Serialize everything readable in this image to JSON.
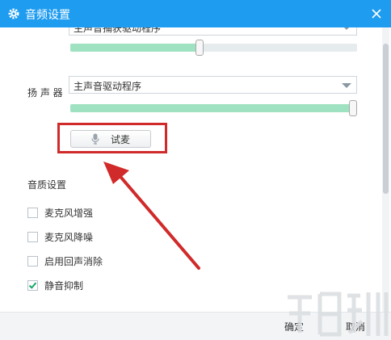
{
  "window": {
    "title": "音频设置"
  },
  "microphone": {
    "device_value": "主声音捕获驱动程序",
    "volume_percent": 45
  },
  "speaker": {
    "label": "扬 声 器",
    "device_value": "主声音驱动程序",
    "volume_percent": 100,
    "test_button_label": "试麦"
  },
  "quality": {
    "section_title": "音质设置",
    "options": [
      {
        "label": "麦克风增强",
        "checked": false
      },
      {
        "label": "麦克风降噪",
        "checked": false
      },
      {
        "label": "启用回声消除",
        "checked": false
      },
      {
        "label": "静音抑制",
        "checked": true
      }
    ]
  },
  "footer": {
    "ok_label": "确定",
    "cancel_label": "取消"
  },
  "colors": {
    "titlebar": "#1e9cf0",
    "slider_fill": "#9fe2c2",
    "highlight": "#d02a2a",
    "check": "#1aa86a"
  }
}
